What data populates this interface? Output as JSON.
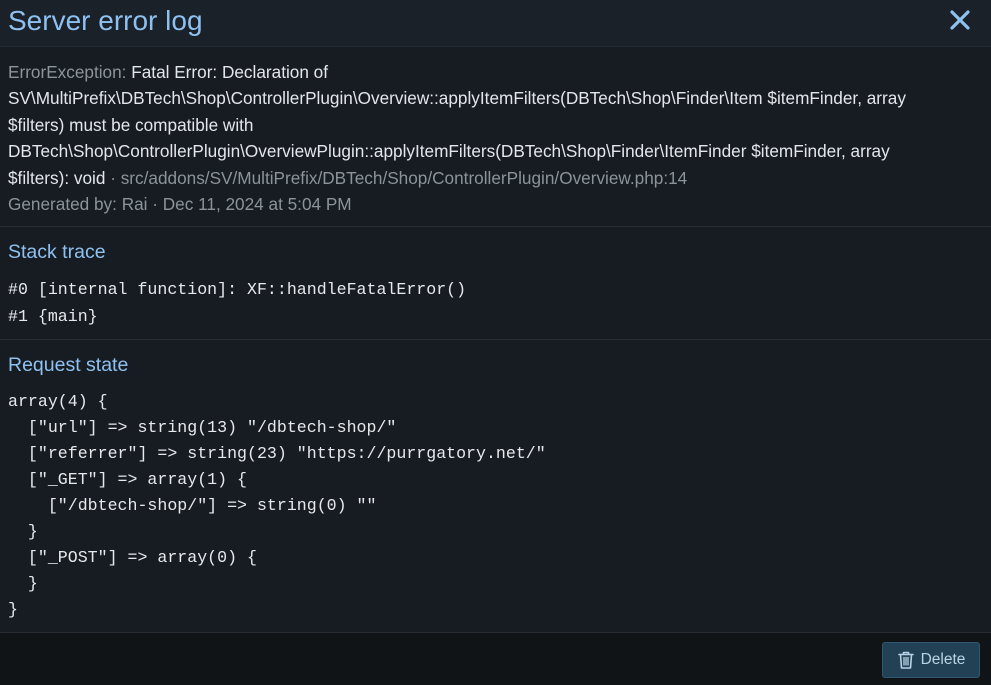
{
  "overlay": {
    "title": "Server error log",
    "close_icon": "close-icon"
  },
  "error": {
    "type": "ErrorException:",
    "message_lines": [
      "Fatal Error: Declaration of",
      "SV\\MultiPrefix\\DBTech\\Shop\\ControllerPlugin\\Overview::applyItemFilters(DBTech\\Shop\\Finder\\Item $itemFinder, array",
      "$filters) must be compatible with",
      "DBTech\\Shop\\ControllerPlugin\\OverviewPlugin::applyItemFilters(DBTech\\Shop\\Finder\\ItemFinder $itemFinder, array",
      "$filters): void"
    ],
    "location": "· src/addons/SV/MultiPrefix/DBTech/Shop/ControllerPlugin/Overview.php:14",
    "generated_by": "Generated by: Rai · Dec 11, 2024 at 5:04 PM"
  },
  "stack_trace": {
    "title": "Stack trace",
    "lines": [
      "#0 [internal function]: XF::handleFatalError()",
      "#1 {main}"
    ]
  },
  "request_state": {
    "title": "Request state",
    "lines": [
      "array(4) {",
      "  [\"url\"] => string(13) \"/dbtech-shop/\"",
      "  [\"referrer\"] => string(23) \"https://purrgatory.net/\"",
      "  [\"_GET\"] => array(1) {",
      "    [\"/dbtech-shop/\"] => string(0) \"\"",
      "  }",
      "  [\"_POST\"] => array(0) {",
      "  }",
      "}"
    ]
  },
  "footer": {
    "delete_label": "Delete",
    "delete_icon": "trash-icon"
  },
  "colors": {
    "accent": "#8fc1f0",
    "muted": "#8b939b",
    "background": "#171c22",
    "button": "#234155"
  }
}
